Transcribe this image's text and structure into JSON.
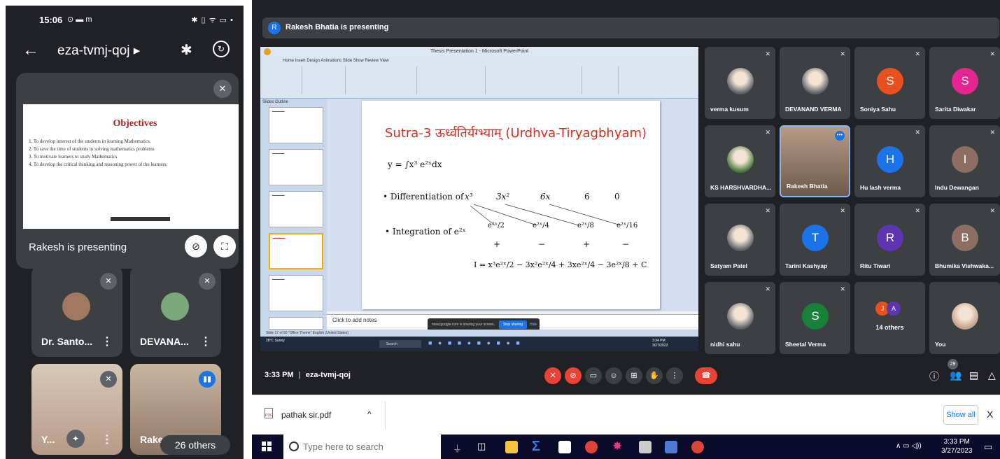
{
  "phone": {
    "time": "15:06",
    "status_icons": "⊙ ▬ m",
    "right_icons": "✱ ▯ ᯤ ▭ •",
    "meeting_code": "eza-tvmj-qoj ▸",
    "presenting_label": "Rakesh is presenting",
    "slide": {
      "title": "Objectives",
      "points": [
        "1. To develop interest of the students in learning Mathematics.",
        "2. To save the time of students in solving mathematics problems",
        "3. To motivate learners to study Mathematics",
        "4. To develop the critical thinking and reasoning power of the learners."
      ]
    },
    "tiles": [
      {
        "name": "Dr. Santo..."
      },
      {
        "name": "DEVANA..."
      },
      {
        "name": "Y..."
      },
      {
        "name": "Rake"
      }
    ],
    "others_label": "26 others"
  },
  "meet": {
    "presenter_initial": "R",
    "presenting_banner": "Rakesh Bhatia is presenting",
    "ppt": {
      "window_title": "Thesis Presentation 1 - Microsoft PowerPoint",
      "tabs": "Home   Insert   Design   Animations   Slide Show   Review   View",
      "outline_tabs": "Slides   Outline",
      "slide_title": "Sutra-3 ऊर्ध्वतिर्यग्भ्याम् (Urdhva-Tiryagbhyam)",
      "y_eq": "y  =  ∫x³ e²ˣdx",
      "diff_label": "• Differentiation of",
      "diff_terms": [
        "x³",
        "3x²",
        "6x",
        "6",
        "0"
      ],
      "int_label": "•  Integration of  e²ˣ",
      "int_terms": [
        "e²ˣ/2",
        "e²ˣ/4",
        "e²ˣ/8",
        "e²ˣ/16"
      ],
      "signs": [
        "+",
        "−",
        "+",
        "−"
      ],
      "result": "I = x³e²ˣ/2 − 3x²e²ˣ/4 + 3xe²ˣ/4 − 3e²ˣ/8 + C",
      "notes_placeholder": "Click to add notes",
      "sharing_text": "meet.google.com is sharing your screen.",
      "stop_sharing": "Stop sharing",
      "hide": "Hide",
      "status_bar": "Slide 17 of 50   \"Office Theme\"   English (United States)",
      "weather": "28°C Sunny",
      "taskbar_search": "Search",
      "tray_time": "3:34 PM",
      "tray_date": "3/27/2023"
    },
    "participants": [
      {
        "name": "verma kusum",
        "initial": "",
        "color": "#5f6368",
        "photo": true
      },
      {
        "name": "DEVANAND VERMA",
        "initial": "",
        "color": "#5f6368",
        "photo": true
      },
      {
        "name": "Soniya Sahu",
        "initial": "S",
        "color": "#e8501f"
      },
      {
        "name": "Sarita Diwakar",
        "initial": "S",
        "color": "#e52592"
      },
      {
        "name": "KS HARSHVARDHA...",
        "initial": "",
        "color": "#4a7a3c",
        "photo": true
      },
      {
        "name": "Rakesh Bhatia",
        "initial": "",
        "color": "#8b7b6a",
        "photo": true,
        "speaking": true
      },
      {
        "name": "Hu lash verma",
        "initial": "H",
        "color": "#1a73e8"
      },
      {
        "name": "Indu Dewangan",
        "initial": "I",
        "color": "#8d6e63"
      },
      {
        "name": "Satyam Patel",
        "initial": "",
        "color": "#5f6368",
        "photo": true
      },
      {
        "name": "Tarini Kashyap",
        "initial": "T",
        "color": "#1a73e8"
      },
      {
        "name": "Ritu Tiwari",
        "initial": "R",
        "color": "#5e35b1"
      },
      {
        "name": "Bhumika Vishwaka...",
        "initial": "B",
        "color": "#8d6e63"
      },
      {
        "name": "nidhi sahu",
        "initial": "",
        "color": "#5f6368",
        "photo": true
      },
      {
        "name": "Sheetal Verma",
        "initial": "S",
        "color": "#188038"
      },
      {
        "name": "14 others",
        "initial": "",
        "color": "#3c4043"
      },
      {
        "name": "You",
        "initial": "",
        "color": "#c6a08a",
        "photo": true
      }
    ],
    "others_avatars": [
      "J",
      "A"
    ],
    "time": "3:33 PM",
    "separator": "|",
    "meeting_code": "eza-tvmj-qoj",
    "participant_count": "29"
  },
  "downloads": {
    "file_name": "pathak sir.pdf",
    "chevron": "^",
    "show_all": "Show all",
    "close": "X"
  },
  "taskbar": {
    "search_placeholder": "Type here to search",
    "time": "3:33 PM",
    "date": "3/27/2023"
  },
  "colors": {
    "meet_bg": "#202124",
    "tile_bg": "#3c4043",
    "hangup_red": "#ea4335",
    "slide_title_red": "#d62d20"
  }
}
